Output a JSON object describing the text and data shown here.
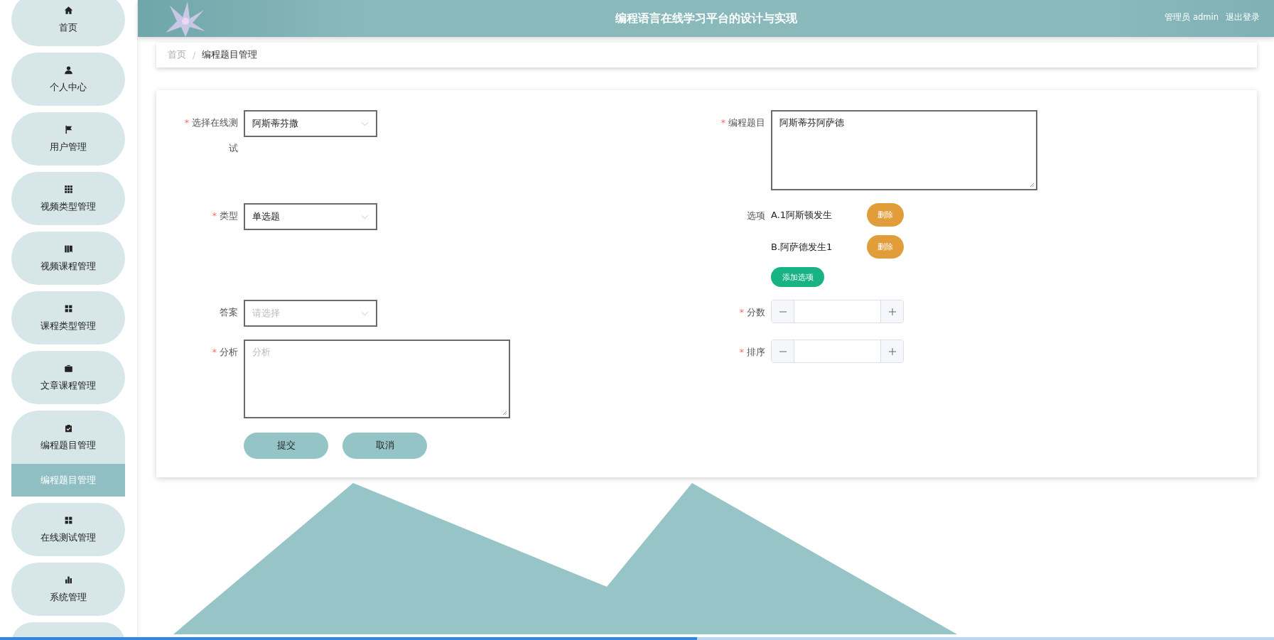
{
  "sidebar": {
    "items": [
      {
        "label": "首页",
        "expanded": false
      },
      {
        "label": "个人中心",
        "expanded": false
      },
      {
        "label": "用户管理",
        "expanded": false
      },
      {
        "label": "视频类型管理",
        "expanded": false
      },
      {
        "label": "视频课程管理",
        "expanded": false
      },
      {
        "label": "课程类型管理",
        "expanded": false
      },
      {
        "label": "文章课程管理",
        "expanded": false
      },
      {
        "label": "编程题目管理",
        "expanded": true,
        "children": [
          {
            "label": "编程题目管理",
            "selected": true
          }
        ]
      },
      {
        "label": "在线测试管理",
        "expanded": false
      },
      {
        "label": "系统管理",
        "expanded": false
      }
    ]
  },
  "header": {
    "title": "编程语言在线学习平台的设计与实现",
    "user": "管理员 admin",
    "logout": "退出登录"
  },
  "breadcrumb": [
    {
      "label": "首页",
      "current": false
    },
    {
      "label": "编程题目管理",
      "current": true
    }
  ],
  "breadcrumb_separator": "/",
  "form": {
    "required_mark": "*",
    "test": {
      "label": "选择在线测试",
      "required": true,
      "value": "阿斯蒂芬撒"
    },
    "title": {
      "label": "编程题目",
      "required": true,
      "value": "阿斯蒂芬阿萨德"
    },
    "type": {
      "label": "类型",
      "required": true,
      "value": "单选题"
    },
    "options": {
      "label": "选项",
      "required": false,
      "items": [
        {
          "text": "A.1阿斯顿发生",
          "delete": "删除"
        },
        {
          "text": "B.阿萨德发生1",
          "delete": "删除"
        }
      ],
      "add": "添加选项"
    },
    "answer": {
      "label": "答案",
      "required": false,
      "placeholder": "请选择"
    },
    "score": {
      "label": "分数",
      "required": true
    },
    "analysis": {
      "label": "分析",
      "required": true,
      "placeholder": "分析"
    },
    "sort": {
      "label": "排序",
      "required": true
    },
    "buttons": [
      "提交",
      "取消"
    ]
  },
  "playback_bar": {
    "level": 0.547
  }
}
